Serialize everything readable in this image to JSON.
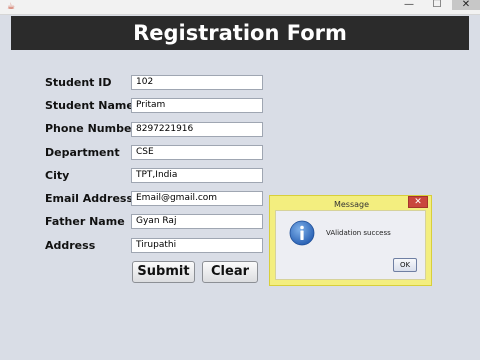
{
  "window": {
    "app_icon": "java-icon",
    "controls": {
      "minimize": "—",
      "maximize": "☐",
      "close": "✕"
    }
  },
  "header": {
    "title": "Registration Form"
  },
  "form": {
    "fields": [
      {
        "label": "Student ID",
        "value": "102"
      },
      {
        "label": "Student Name",
        "value": "Pritam"
      },
      {
        "label": "Phone Number",
        "value": "8297221916"
      },
      {
        "label": "Department",
        "value": "CSE"
      },
      {
        "label": "City",
        "value": "TPT,India"
      },
      {
        "label": "Email Address",
        "value": "Email@gmail.com"
      },
      {
        "label": "Father Name",
        "value": "Gyan Raj"
      },
      {
        "label": "Address",
        "value": "Tirupathi"
      }
    ],
    "buttons": {
      "submit": "Submit",
      "clear": "Clear"
    }
  },
  "dialog": {
    "title": "Message",
    "close": "✕",
    "icon": "info-icon",
    "message": "VAlidation success",
    "ok": "OK"
  },
  "colors": {
    "header_bg": "#2b2b2b",
    "window_bg": "#d9dde6",
    "dialog_border": "#f3ee7f",
    "info_icon": "#2f6fc0"
  }
}
